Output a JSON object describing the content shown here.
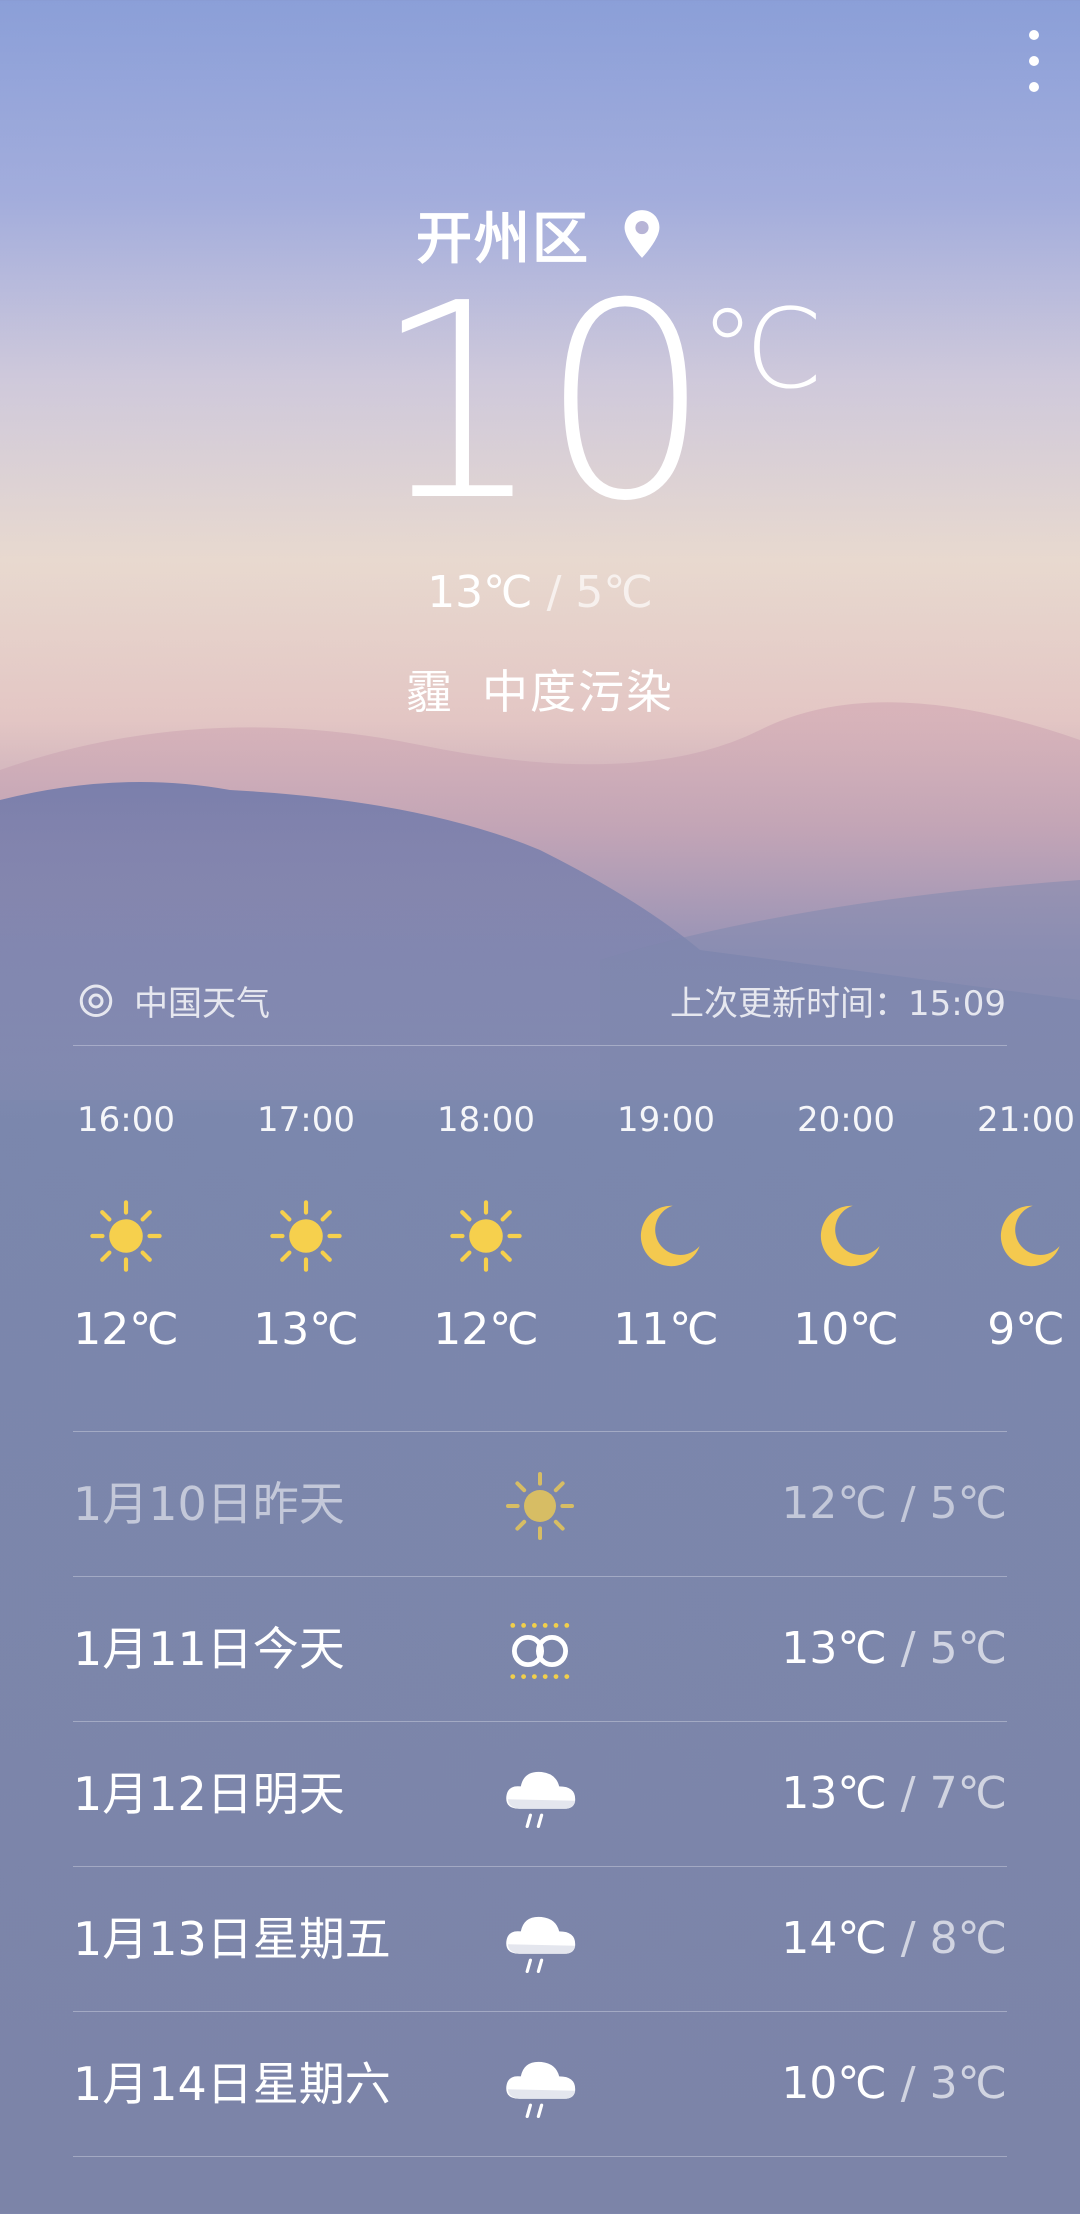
{
  "header": {
    "city": "开州区",
    "current_temp": "10",
    "temp_unit": "℃",
    "high": "13℃",
    "separator": " / ",
    "low": "5℃",
    "weather_condition": "霾",
    "air_quality": "中度污染"
  },
  "source": {
    "label": "中国天气",
    "update_text": "上次更新时间：15:09"
  },
  "hourly": [
    {
      "time": "16:00",
      "icon": "sun-icon",
      "temp": "12℃"
    },
    {
      "time": "17:00",
      "icon": "sun-icon",
      "temp": "13℃"
    },
    {
      "time": "18:00",
      "icon": "sun-icon",
      "temp": "12℃"
    },
    {
      "time": "19:00",
      "icon": "moon-icon",
      "temp": "11℃"
    },
    {
      "time": "20:00",
      "icon": "moon-icon",
      "temp": "10℃"
    },
    {
      "time": "21:00",
      "icon": "moon-icon",
      "temp": "9℃"
    }
  ],
  "daily": [
    {
      "day": "1月10日昨天",
      "icon": "sun-icon",
      "high": "12℃",
      "sep": " / ",
      "low": "5℃"
    },
    {
      "day": "1月11日今天",
      "icon": "haze-icon",
      "high": "13℃",
      "sep": " / ",
      "low": "5℃"
    },
    {
      "day": "1月12日明天",
      "icon": "cloud-rain-icon",
      "high": "13℃",
      "sep": " / ",
      "low": "7℃"
    },
    {
      "day": "1月13日星期五",
      "icon": "cloud-rain-icon",
      "high": "14℃",
      "sep": " / ",
      "low": "8℃"
    },
    {
      "day": "1月14日星期六",
      "icon": "cloud-rain-icon",
      "high": "10℃",
      "sep": " / ",
      "low": "3℃"
    }
  ],
  "colors": {
    "sun": "#f6d04d",
    "moon": "#f4c94f",
    "haze": "#f1cf4a"
  }
}
